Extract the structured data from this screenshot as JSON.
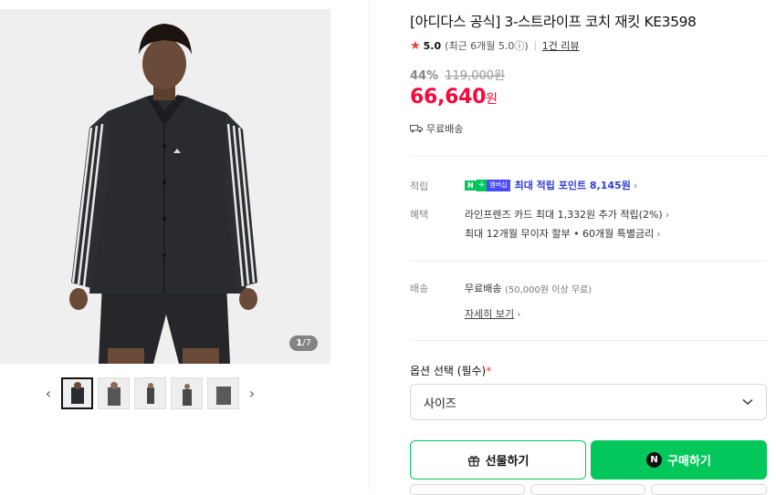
{
  "gallery": {
    "counter_current": "1",
    "counter_total": "/7",
    "prev_arrow": "‹",
    "next_arrow": "›"
  },
  "product": {
    "title": "[아디다스 공식] 3-스트라이프 코치 재킷 KE3598",
    "rating_score": "5.0",
    "rating_recent": "(최근 6개월 5.0ⓘ)",
    "review_link": "1건 리뷰",
    "discount_pct": "44%",
    "original_price": "119,000원",
    "sale_price": "66,640",
    "currency": "원",
    "shipping": "무료배송"
  },
  "benefits": {
    "points_label": "적립",
    "points_text": "최대 적립 포인트 8,145원",
    "membership_badge": "멤버십",
    "benefit_label": "혜택",
    "benefit_line1": "라인프렌즈 카드 최대 1,332원 추가 적립(2%)",
    "benefit_line2": "최대 12개월 무이자 할부 • 60개월 특별금리"
  },
  "delivery": {
    "label": "배송",
    "text": "무료배송",
    "note": "(50,000원 이상 무료)",
    "detail_link": "자세히 보기"
  },
  "options": {
    "label": "옵션 선택 (필수)",
    "required_mark": "*",
    "select_value": "사이즈"
  },
  "actions": {
    "gift_label": "선물하기",
    "buy_label": "구매하기",
    "npay_mark": "N"
  },
  "colors": {
    "brand_green": "#03c75a",
    "price_red": "#f7093a",
    "link_blue": "#2c3ed6"
  }
}
